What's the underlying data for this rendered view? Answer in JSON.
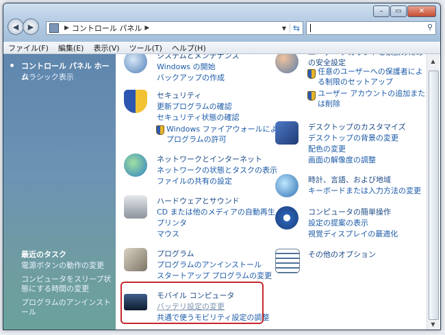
{
  "window": {
    "controls": [
      "–",
      "▭",
      "✕"
    ]
  },
  "address": {
    "path": [
      "コントロール パネル"
    ],
    "search_placeholder": ""
  },
  "menu": [
    "ファイル(F)",
    "編集(E)",
    "表示(V)",
    "ツール(T)",
    "ヘルプ(H)"
  ],
  "sidebar": {
    "home": "コントロール パネル ホーム",
    "classic": "クラシック表示",
    "tasks_title": "最近のタスク",
    "tasks": [
      "電源ボタンの動作の変更",
      "コンピュータをスリープ状態にする時間の変更",
      "プログラムのアンインストール"
    ]
  },
  "categories_left": [
    {
      "title": "システムとメンテナンス",
      "links": [
        "Windows の開始",
        "バックアップの作成"
      ]
    },
    {
      "title": "セキュリティ",
      "links": [
        "更新プログラムの確認",
        "セキュリティ状態の確認",
        "Windows ファイアウォールによるプログラムの許可"
      ]
    },
    {
      "title": "ネットワークとインターネット",
      "links": [
        "ネットワークの状態とタスクの表示",
        "ファイルの共有の設定"
      ]
    },
    {
      "title": "ハードウェアとサウンド",
      "links": [
        "CD または他のメディアの自動再生",
        "プリンタ",
        "マウス"
      ]
    },
    {
      "title": "プログラム",
      "links": [
        "プログラムのアンインストール",
        "スタートアップ プログラムの変更"
      ]
    },
    {
      "title": "モバイル コンピュータ",
      "links": [
        "バッテリ設定の変更",
        "共通で使うモビリティ設定の調整"
      ]
    }
  ],
  "categories_right": [
    {
      "title": "ユーザー アカウントと家族のための安全設定",
      "links": [
        "任意のユーザーへの保護者による制限のセットアップ",
        "ユーザー アカウントの追加または削除"
      ]
    },
    {
      "title": "デスクトップのカスタマイズ",
      "links": [
        "デスクトップの背景の変更",
        "配色の変更",
        "画面の解像度の調整"
      ]
    },
    {
      "title": "時計、言語、および地域",
      "links": [
        "キーボードまたは入力方法の変更"
      ]
    },
    {
      "title": "コンピュータの簡単操作",
      "links": [
        "設定の提案の表示",
        "視覚ディスプレイの最適化"
      ]
    },
    {
      "title": "その他のオプション",
      "links": []
    }
  ],
  "colors": {
    "link": "#1b5aa8",
    "highlight_border": "#c5262b",
    "sidebar_top": "#5f86ad",
    "sidebar_bottom": "#6aa29b"
  }
}
